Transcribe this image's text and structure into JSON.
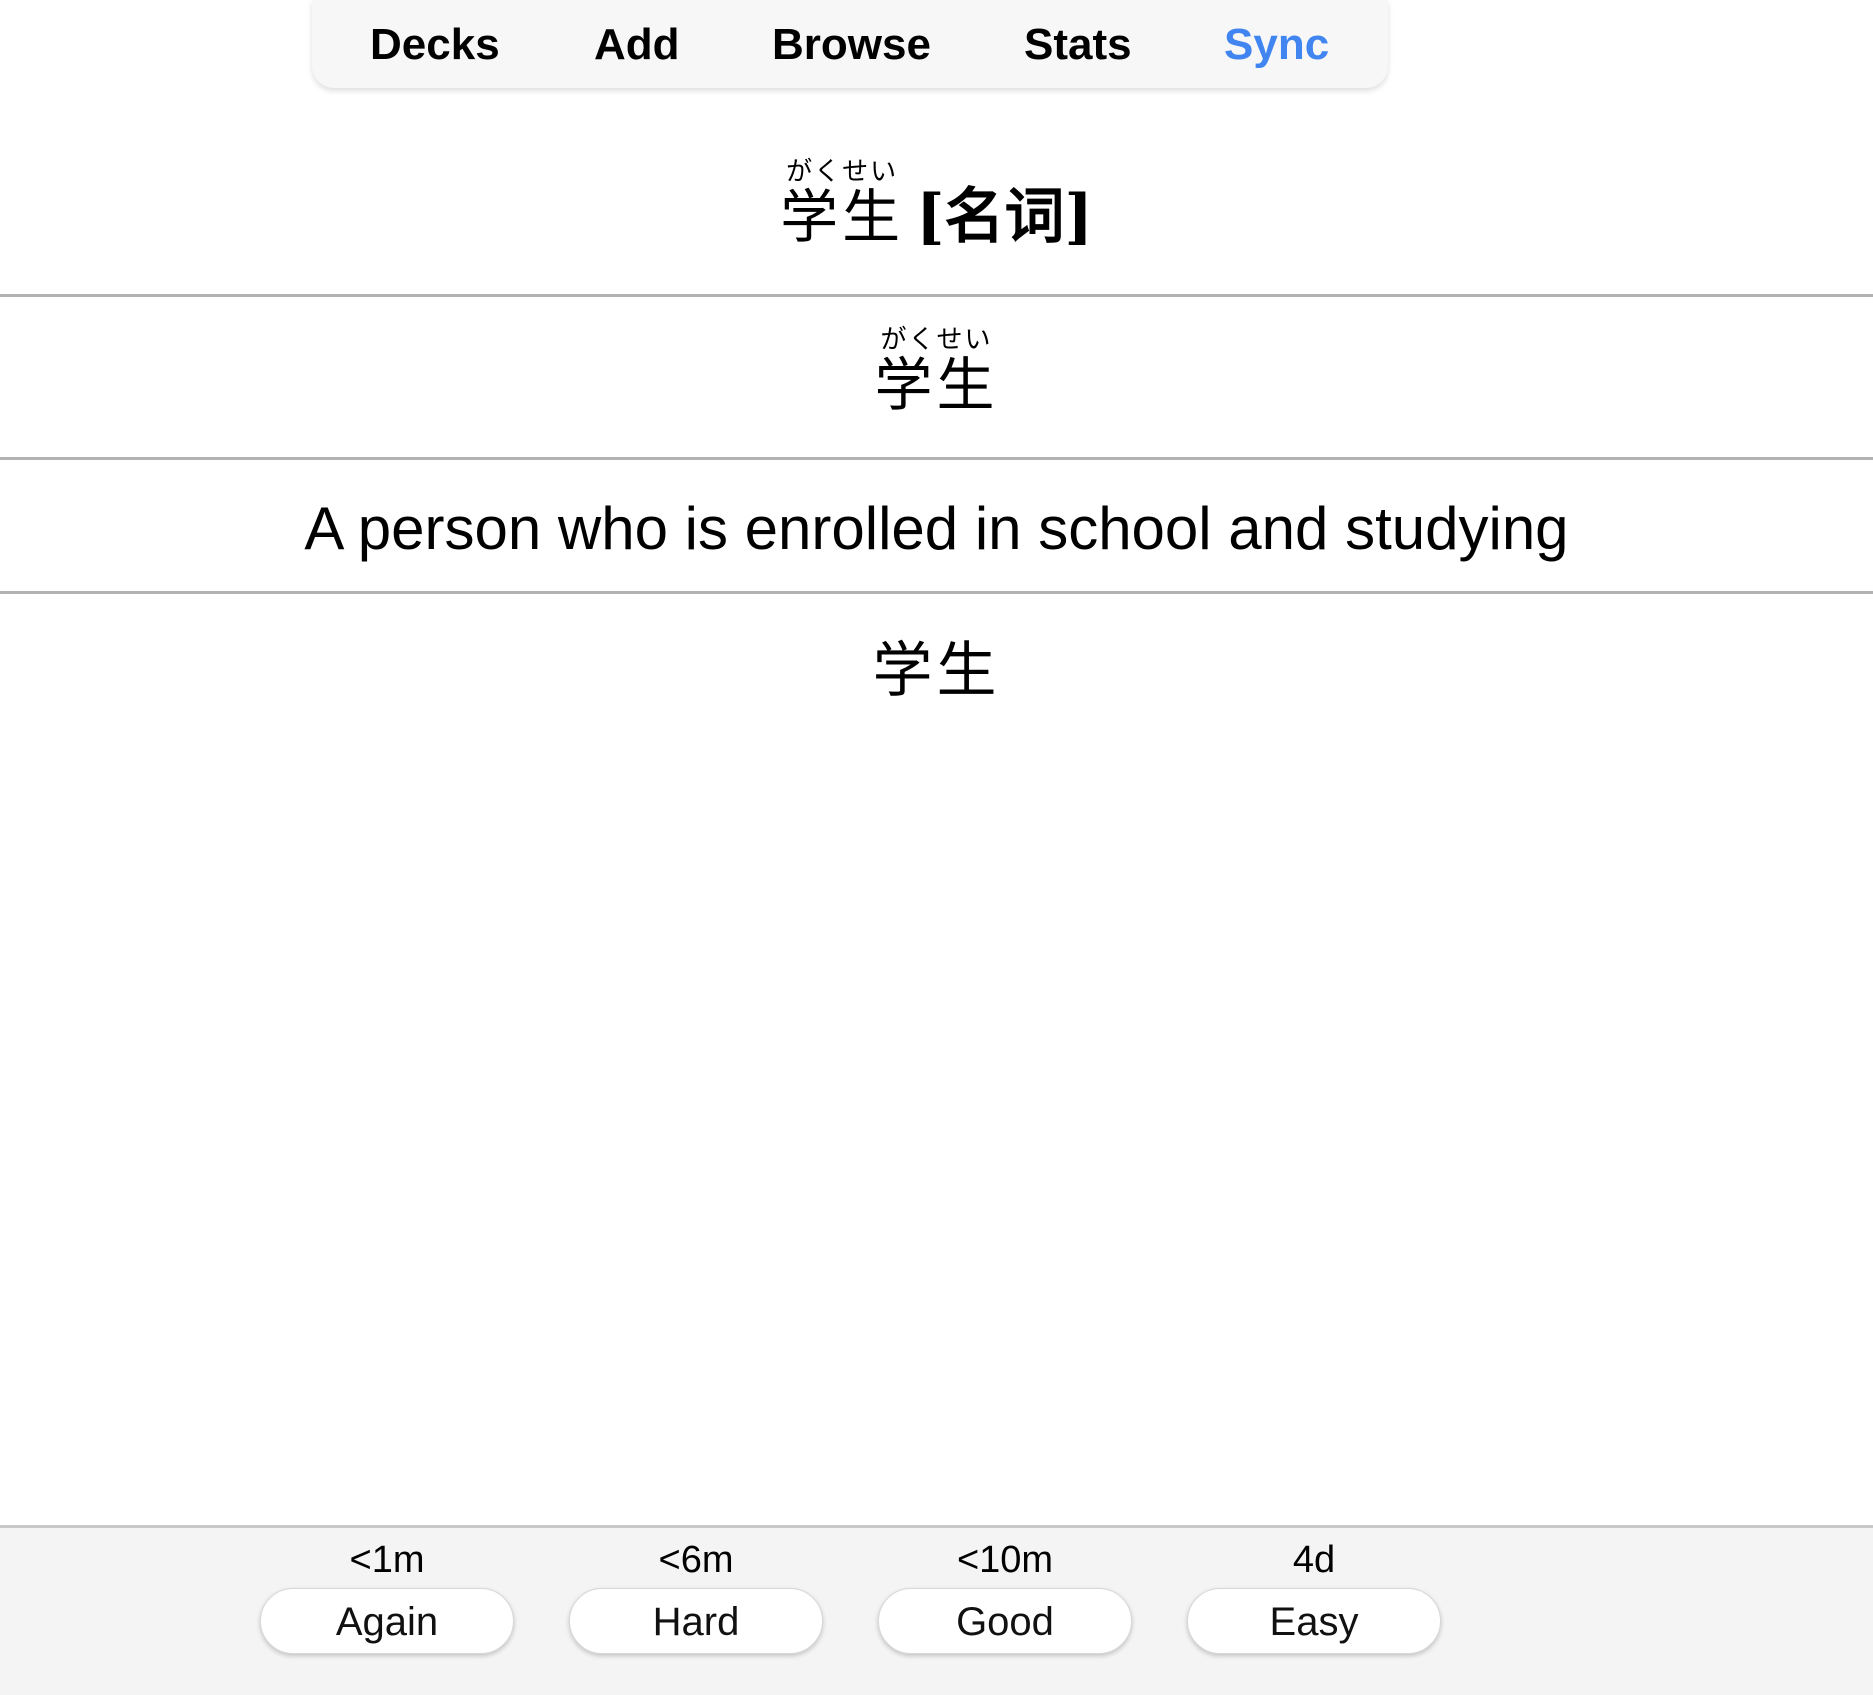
{
  "nav": {
    "items": [
      {
        "label": "Decks"
      },
      {
        "label": "Add"
      },
      {
        "label": "Browse"
      },
      {
        "label": "Stats"
      },
      {
        "label": "Sync",
        "active": true
      }
    ],
    "active_color": "#4185f0"
  },
  "card": {
    "front": {
      "reading": "がくせい",
      "word": "学生",
      "pos": "[名词]"
    },
    "reading_field": {
      "reading": "がくせい",
      "word": "学生"
    },
    "meaning": "A person who is enrolled in school and studying",
    "answer_word": "学生"
  },
  "answer_buttons": [
    {
      "interval": "<1m",
      "label": "Again"
    },
    {
      "interval": "<6m",
      "label": "Hard"
    },
    {
      "interval": "<10m",
      "label": "Good"
    },
    {
      "interval": "4d",
      "label": "Easy"
    }
  ]
}
